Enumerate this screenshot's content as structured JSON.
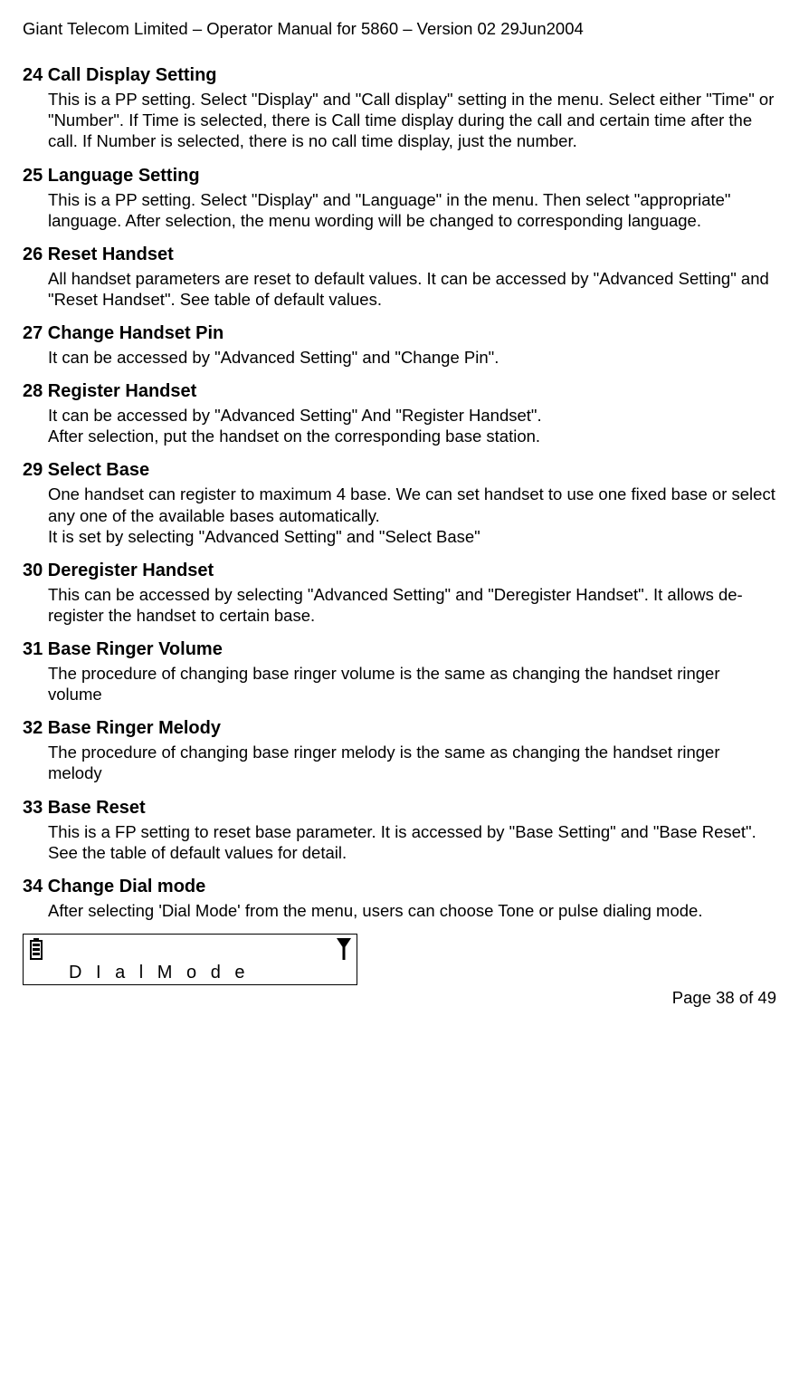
{
  "header": "Giant Telecom Limited – Operator Manual for 5860 – Version 02 29Jun2004",
  "sections": [
    {
      "num": "24",
      "title": "Call Display Setting",
      "body": "This is a PP setting. Select \"Display\" and \"Call display\" setting in the menu. Select either \"Time\" or \"Number\". If Time is selected, there is Call time display during the call and certain time after the call. If Number is selected, there is no call time display, just the number."
    },
    {
      "num": "25",
      "title": "Language Setting",
      "body": "This is a PP setting. Select \"Display\" and \"Language\" in the menu. Then select \"appropriate\" language. After selection, the menu wording will be changed to corresponding language."
    },
    {
      "num": "26",
      "title": "Reset Handset",
      "body": "All handset parameters are reset to default values. It can be accessed by \"Advanced Setting\" and \"Reset Handset\". See table of default values."
    },
    {
      "num": "27",
      "title": "Change Handset Pin",
      "body": "It can be accessed by \"Advanced Setting\" and \"Change Pin\"."
    },
    {
      "num": "28",
      "title": "Register Handset",
      "body": "It can be accessed by \"Advanced Setting\" And \"Register Handset\".\nAfter selection, put the handset on the corresponding base station."
    },
    {
      "num": "29",
      "title": "Select Base",
      "body": "One handset can register to maximum 4 base. We can set handset to use one fixed base or select any one of the available bases automatically.\nIt is set by selecting \"Advanced Setting\" and \"Select Base\""
    },
    {
      "num": "30",
      "title": "Deregister Handset",
      "body": "This can be accessed by selecting \"Advanced Setting\" and \"Deregister Handset\". It allows de-register the handset to certain base."
    },
    {
      "num": "31",
      "title": "Base Ringer Volume",
      "body": "The procedure of changing base ringer volume is the same as changing the handset ringer volume"
    },
    {
      "num": "32",
      "title": "Base Ringer Melody",
      "body": "The procedure of changing base ringer melody is the same as changing the handset ringer melody"
    },
    {
      "num": "33",
      "title": "Base Reset",
      "body": "This is a FP setting to reset base parameter. It is accessed by \"Base Setting\" and \"Base Reset\". See the table of default values for detail."
    },
    {
      "num": "34",
      "title": "Change Dial mode",
      "body": "After selecting 'Dial Mode' from the menu, users can choose Tone or pulse dialing mode."
    }
  ],
  "display": {
    "text": "D I a l   M o d e"
  },
  "footer": "Page 38 of 49"
}
